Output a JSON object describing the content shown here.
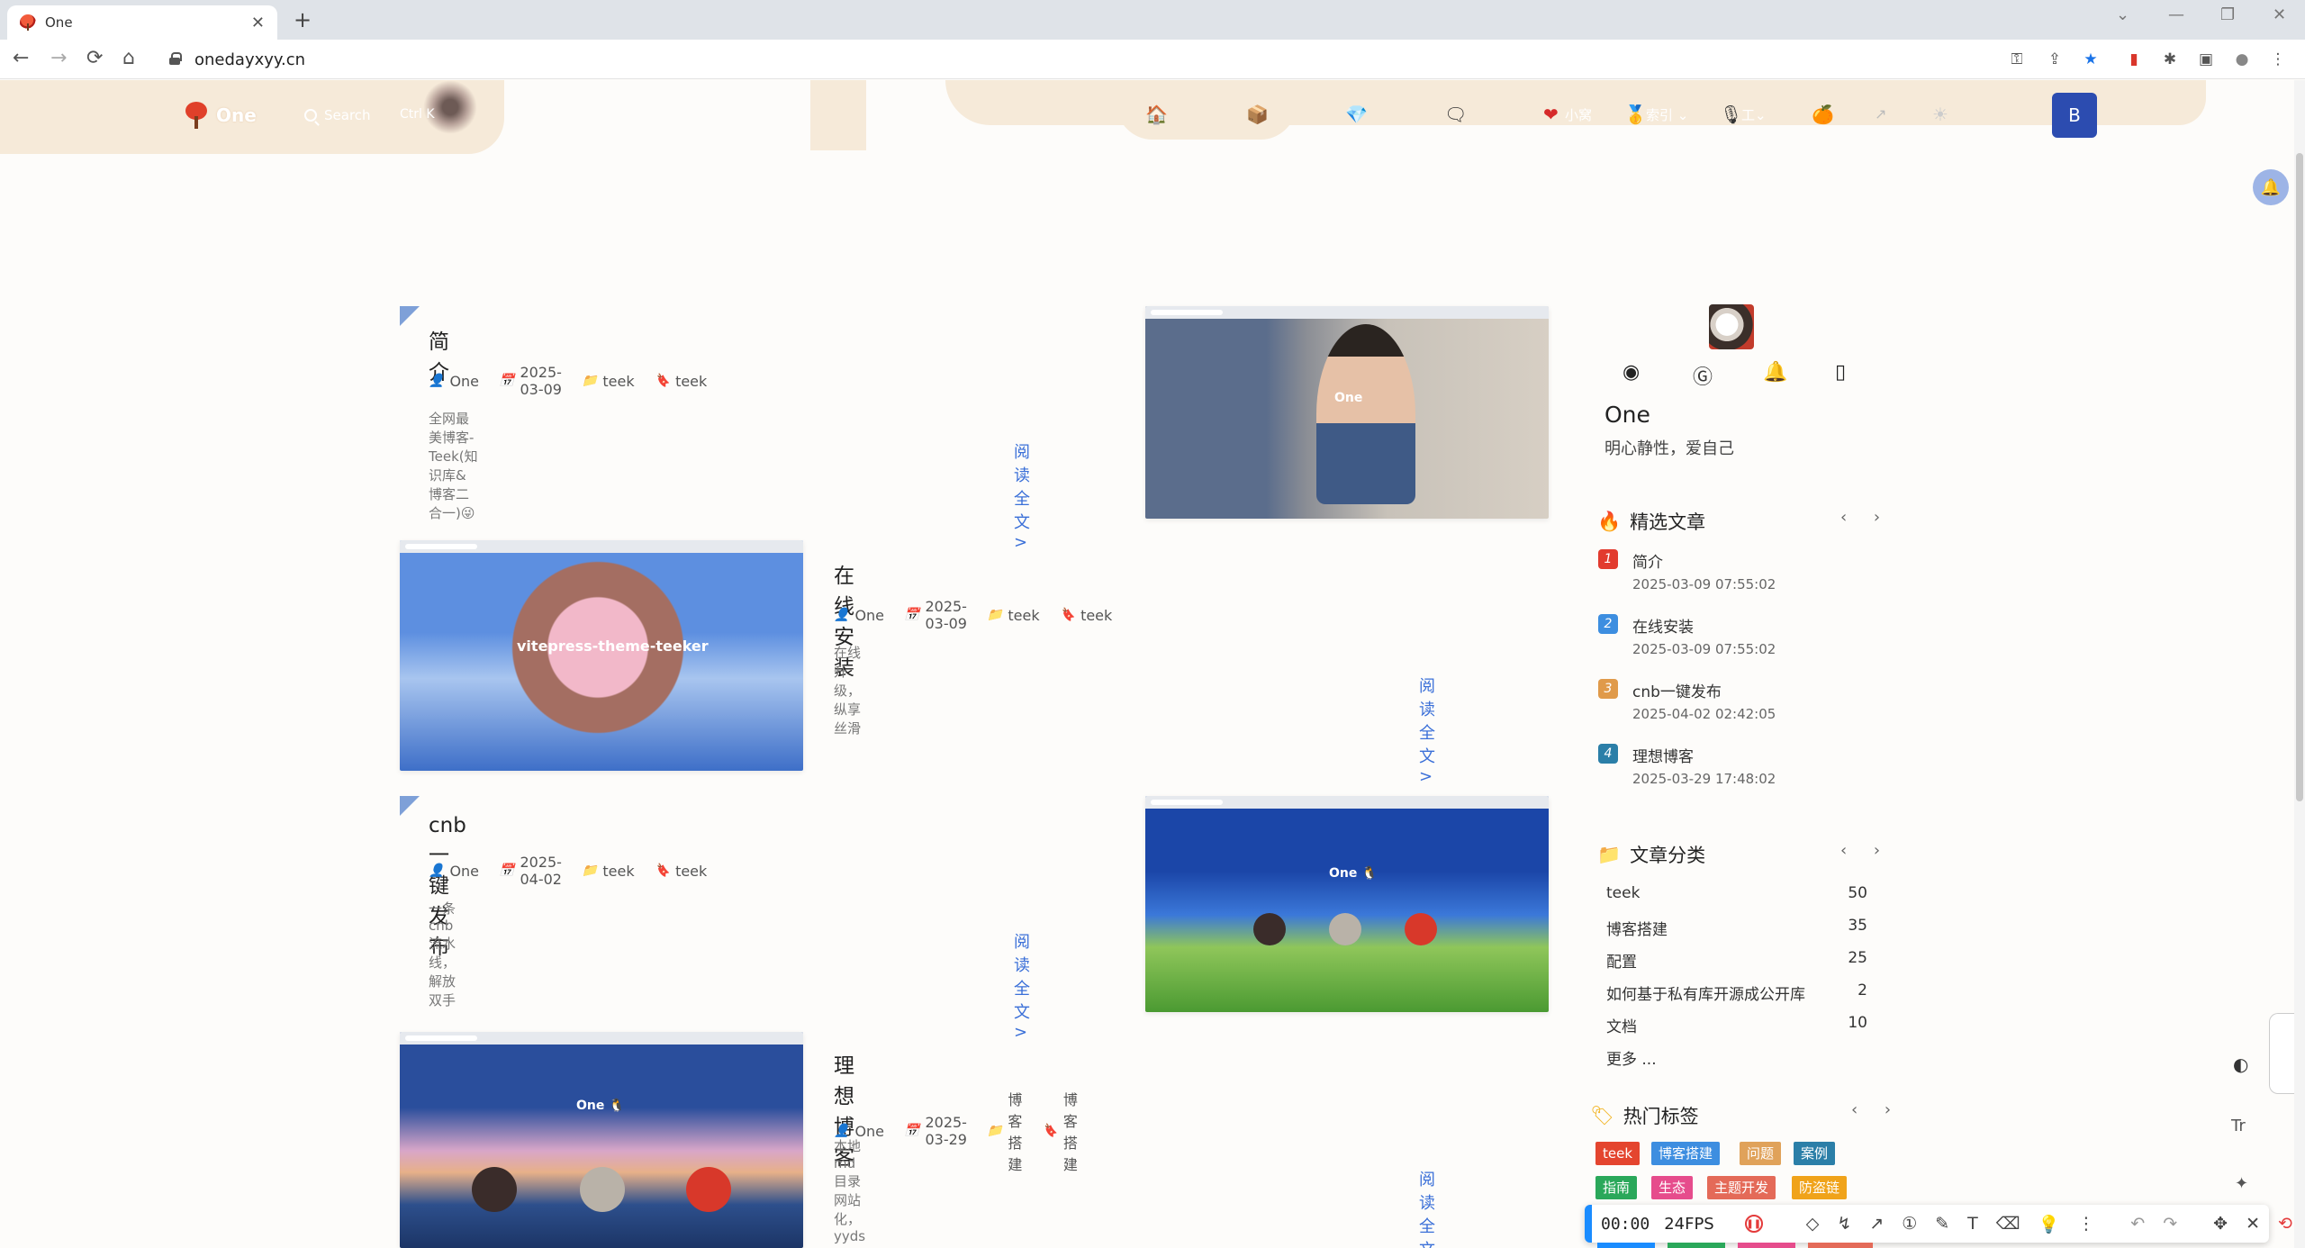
{
  "browser": {
    "tab_title": "One",
    "tab_close": "✕",
    "new_tab": "+",
    "url": "onedayxyy.cn",
    "nav": {
      "back": "←",
      "forward": "→",
      "reload": "⟳",
      "home": "⌂"
    },
    "window": {
      "minimize": "—",
      "restore": "❐",
      "close": "✕",
      "tab_search": "⌄"
    },
    "extensions": [
      "key-icon",
      "share-icon",
      "star-icon",
      "bookmark-icon",
      "puzzle-icon",
      "sidebar-icon",
      "profile-icon",
      "menu-icon"
    ],
    "extension_glyphs": [
      "⚿",
      "⇪",
      "★",
      "▮",
      "✱",
      "▣",
      "●",
      "⋮"
    ]
  },
  "site": {
    "name": "One",
    "search": {
      "label": "Search",
      "shortcut": "Ctrl K"
    },
    "nav_items": [
      {
        "icon": "🏠",
        "label": ""
      },
      {
        "icon": "📦",
        "label": ""
      },
      {
        "icon": "💎",
        "label": ""
      },
      {
        "icon": "🗨",
        "label": ""
      },
      {
        "icon": "❤",
        "label": "小窝"
      },
      {
        "icon": "🥇",
        "label": "索引 ⌄"
      },
      {
        "icon": "🎙",
        "label": "工⌄"
      },
      {
        "icon": "🍊",
        "label": ""
      },
      {
        "icon": "↗",
        "label": ""
      },
      {
        "icon": "☀",
        "label": ""
      }
    ],
    "user_avatar_letter": "B",
    "bell_icon": "🔔"
  },
  "posts": [
    {
      "title": "简介",
      "author": "One",
      "date": "2025-03-09",
      "category": "teek",
      "tag": "teek",
      "excerpt": "全网最美博客-Teek(知识库&博客二合一)😜",
      "read_more": "阅读全文 >",
      "thumb_caption": "One"
    },
    {
      "title": "在线安装",
      "author": "One",
      "date": "2025-03-09",
      "category": "teek",
      "tag": "teek",
      "excerpt": "在线升级，纵享丝滑",
      "read_more": "阅读全文 >",
      "thumb_caption": "vitepress-theme-teeker"
    },
    {
      "title": "cnb一键发布",
      "author": "One",
      "date": "2025-04-02",
      "category": "teek",
      "tag": "teek",
      "excerpt": "一条cnb流水线，解放双手",
      "read_more": "阅读全文 >",
      "thumb_caption": "One 🐧"
    },
    {
      "title": "理想博客",
      "author": "One",
      "date": "2025-03-29",
      "category": "博客搭建",
      "tag": "博客搭建",
      "excerpt": "本地md目录网站化，yyds",
      "read_more": "阅读全文 >",
      "thumb_caption": "One 🐧"
    }
  ],
  "profile": {
    "name": "One",
    "motto": "明心静性，爱自己",
    "social": [
      "github-icon",
      "gitee-icon",
      "qq-icon",
      "phone-icon"
    ],
    "social_glyphs": [
      "◉",
      "Ⓖ",
      "🔔",
      "▯"
    ]
  },
  "featured": {
    "title": "精选文章",
    "arrows": "‹ ›",
    "items": [
      {
        "rank": "1",
        "title": "简介",
        "date": "2025-03-09 07:55:02",
        "color": "#e23b2e"
      },
      {
        "rank": "2",
        "title": "在线安装",
        "date": "2025-03-09 07:55:02",
        "color": "#3d8ee0"
      },
      {
        "rank": "3",
        "title": "cnb一键发布",
        "date": "2025-04-02 02:42:05",
        "color": "#e09a4a"
      },
      {
        "rank": "4",
        "title": "理想博客",
        "date": "2025-03-29 17:48:02",
        "color": "#2b7fa8"
      }
    ]
  },
  "categories": {
    "title": "文章分类",
    "arrows": "‹ ›",
    "items": [
      {
        "name": "teek",
        "count": "50"
      },
      {
        "name": "博客搭建",
        "count": "35"
      },
      {
        "name": "配置",
        "count": "25"
      },
      {
        "name": "如何基于私有库开源成公开库",
        "count": "2"
      },
      {
        "name": "文档",
        "count": "10"
      }
    ],
    "more": "更多 ..."
  },
  "tags": {
    "title": "热门标签",
    "arrows": "‹ ›",
    "items": [
      {
        "label": "teek",
        "color": "#e4452f"
      },
      {
        "label": "博客搭建",
        "color": "#3d8ee0"
      },
      {
        "label": "问题",
        "color": "#e0a25a"
      },
      {
        "label": "案例",
        "color": "#2b7fa8"
      },
      {
        "label": "指南",
        "color": "#2aa85a"
      },
      {
        "label": "生态",
        "color": "#e64c8c"
      },
      {
        "label": "主题开发",
        "color": "#e46a58"
      },
      {
        "label": "防盗链",
        "color": "#f0a31a"
      }
    ]
  },
  "float_tools": {
    "translate": "Tr",
    "magic": "✦",
    "theme": "◐"
  },
  "recorder": {
    "time": "00:00",
    "fps": "24FPS",
    "tools": [
      "◇",
      "↯",
      "↗",
      "①",
      "✎",
      "T",
      "⌫",
      "💡",
      "⋮",
      "↶",
      "↷",
      "✥",
      "✕",
      "⟲"
    ]
  }
}
